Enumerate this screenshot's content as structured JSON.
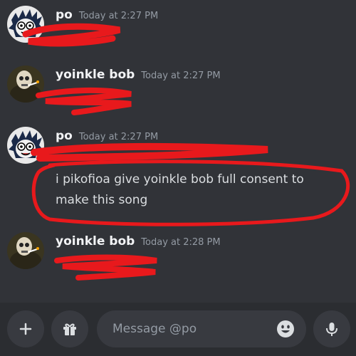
{
  "messages": [
    {
      "author": "po",
      "timestamp": "Today at 2:27 PM"
    },
    {
      "author": "yoinkle bob",
      "timestamp": "Today at 2:27 PM"
    },
    {
      "author": "po",
      "timestamp": "Today at 2:27 PM",
      "text": "i pikofioa give yoinkle bob full consent to make this song"
    },
    {
      "author": "yoinkle bob",
      "timestamp": "Today at 2:28 PM"
    }
  ],
  "composer": {
    "placeholder": "Message @po",
    "add_icon": "plus-icon",
    "gift_icon": "gift-icon",
    "emoji_icon": "emoji-icon",
    "mic_icon": "microphone-icon"
  },
  "colors": {
    "background": "#313338",
    "annotation_red": "#e8191c",
    "timestamp": "#949ba4"
  }
}
